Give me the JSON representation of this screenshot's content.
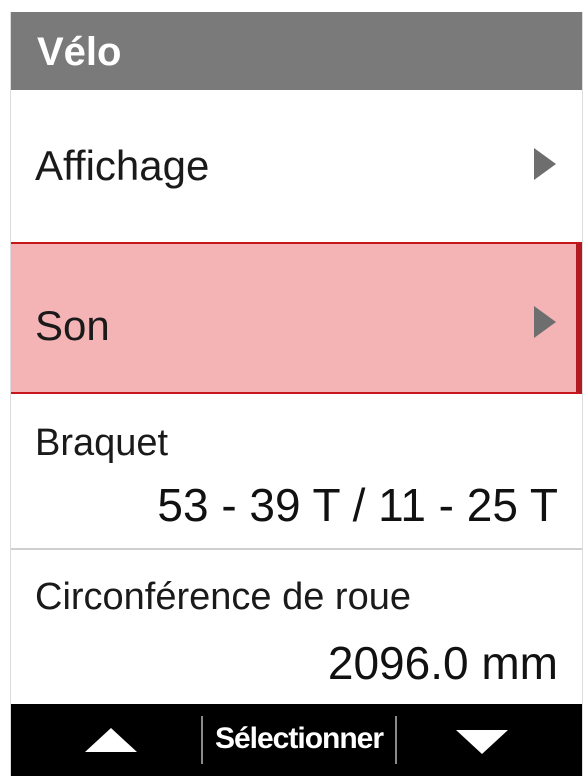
{
  "header": {
    "title": "Vélo"
  },
  "menu": {
    "items": [
      {
        "label": "Affichage",
        "icon": "chevron-right-icon",
        "selected": false
      },
      {
        "label": "Son",
        "icon": "chevron-right-icon",
        "selected": true
      }
    ]
  },
  "settings": {
    "gearing": {
      "label": "Braquet",
      "value": "53 - 39 T / 11 - 25 T"
    },
    "wheel_circumference": {
      "label": "Circonférence de roue",
      "value": "2096.0 mm"
    }
  },
  "footer": {
    "up_icon": "triangle-up-icon",
    "select_label": "Sélectionner",
    "down_icon": "triangle-down-icon"
  },
  "colors": {
    "title_bar": "#7a7a7a",
    "selected_fill": "#f4b3b5",
    "selected_border": "#c8161d",
    "footer_bg": "#000000"
  }
}
